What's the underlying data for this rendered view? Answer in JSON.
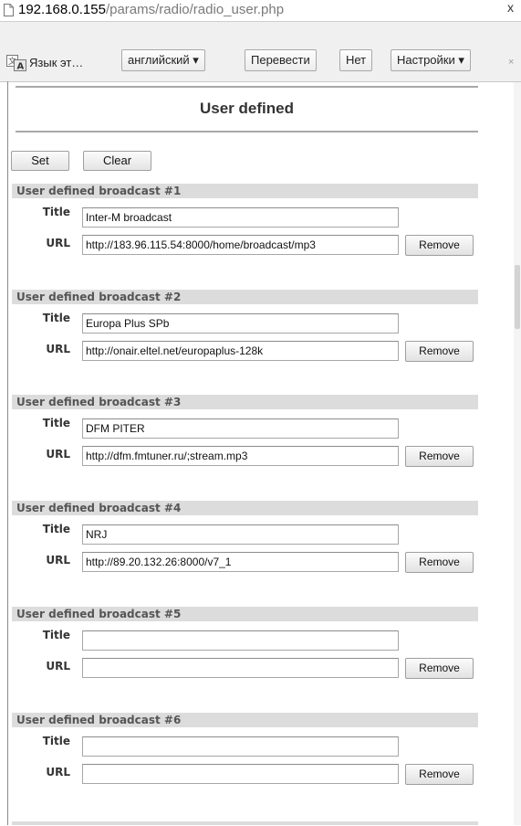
{
  "browser": {
    "url_host": "192.168.0.155",
    "url_path": "/params/radio/radio_user.php",
    "corner_mark": "x"
  },
  "translate_bar": {
    "language_text": "Язык эт…",
    "language_select": "английский ▾",
    "translate_button": "Перевести",
    "no_button": "Нет",
    "settings_button": "Настройки ▾",
    "close": "×"
  },
  "page": {
    "title": "User defined",
    "set_button": "Set",
    "clear_button": "Clear",
    "title_label": "Title",
    "url_label": "URL",
    "remove_label": "Remove",
    "broadcasts": [
      {
        "header": "User defined broadcast #1",
        "title": "Inter-M broadcast",
        "url": "http://183.96.115.54:8000/home/broadcast/mp3"
      },
      {
        "header": "User defined broadcast #2",
        "title": "Europa Plus SPb",
        "url": "http://onair.eltel.net/europaplus-128k"
      },
      {
        "header": "User defined broadcast #3",
        "title": "DFM PITER",
        "url": "http://dfm.fmtuner.ru/;stream.mp3"
      },
      {
        "header": "User defined broadcast #4",
        "title": "NRJ",
        "url": "http://89.20.132.26:8000/v7_1"
      },
      {
        "header": "User defined broadcast #5",
        "title": "",
        "url": ""
      },
      {
        "header": "User defined broadcast #6",
        "title": "",
        "url": ""
      }
    ]
  }
}
